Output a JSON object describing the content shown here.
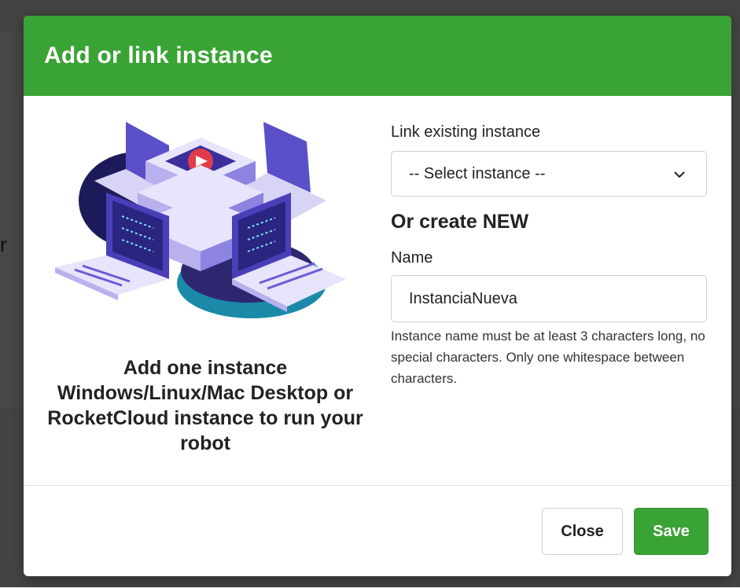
{
  "background": {
    "partial_text": "r"
  },
  "modal": {
    "title": "Add or link instance",
    "caption": "Add one instance Windows/Linux/Mac Desktop or RocketCloud instance to run your robot",
    "link_label": "Link existing instance",
    "select": {
      "selected": "-- Select instance --"
    },
    "create_heading": "Or create NEW",
    "name_label": "Name",
    "name_input": {
      "value": "InstanciaNueva"
    },
    "hint": "Instance name must be at least 3 characters long, no special characters. Only one whitespace between characters.",
    "buttons": {
      "close": "Close",
      "save": "Save"
    }
  },
  "colors": {
    "header": "#3aa335",
    "save_button": "#3aa335",
    "illustration_primary": "#6a5cd6",
    "illustration_accent": "#e23b4a"
  },
  "icons": {
    "select_arrow": "chevron-down-icon",
    "illustration": "server-network-illustration"
  }
}
